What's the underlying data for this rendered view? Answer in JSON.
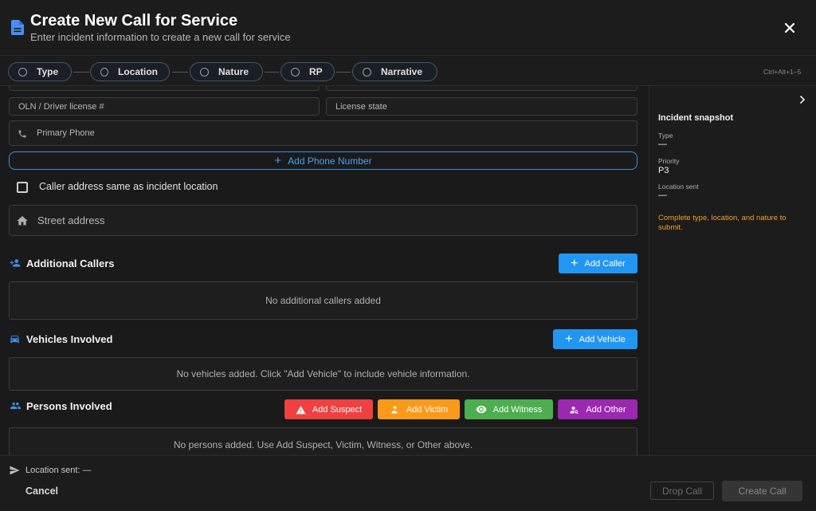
{
  "header": {
    "title": "Create New Call for Service",
    "subtitle": "Enter incident information to create a new call for service",
    "icons": {
      "document": "document-icon",
      "close": "close-icon"
    }
  },
  "stepper": {
    "steps": [
      {
        "label": "Type"
      },
      {
        "label": "Location"
      },
      {
        "label": "Nature"
      },
      {
        "label": "RP"
      },
      {
        "label": "Narrative"
      }
    ],
    "shortcut": "Ctrl+Alt+1–5"
  },
  "form": {
    "oln_placeholder": "OLN / Driver license #",
    "license_state_placeholder": "License state",
    "primary_phone_placeholder": "Primary Phone",
    "add_phone_label": "Add Phone Number",
    "same_address_label": "Caller address same as incident location",
    "street_address_placeholder": "Street address"
  },
  "additional_callers": {
    "title": "Additional Callers",
    "add_label": "Add Caller",
    "empty_text": "No additional callers added"
  },
  "vehicles": {
    "title": "Vehicles Involved",
    "add_label": "Add Vehicle",
    "empty_text": "No vehicles added. Click \"Add Vehicle\" to include vehicle information."
  },
  "persons": {
    "title": "Persons Involved",
    "buttons": [
      {
        "label": "Add Suspect",
        "color": "#f04040"
      },
      {
        "label": "Add Victim",
        "color": "#fb9a1a"
      },
      {
        "label": "Add Witness",
        "color": "#4cae4f"
      },
      {
        "label": "Add Other",
        "color": "#9c27b0"
      }
    ],
    "empty_text": "No persons added. Use Add Suspect, Victim, Witness, or Other above."
  },
  "snapshot": {
    "title": "Incident snapshot",
    "type_label": "Type",
    "type_value": "—",
    "priority_label": "Priority",
    "priority_value": "P3",
    "location_label": "Location sent",
    "location_value": "—",
    "warning": "Complete type, location, and nature to submit."
  },
  "footer": {
    "location_sent": "Location sent: —",
    "cancel_label": "Cancel",
    "drop_call_label": "Drop Call",
    "create_call_label": "Create Call"
  },
  "colors": {
    "accent_blue": "#2196f3",
    "warning": "#f0a030",
    "background": "#1a1a1a"
  }
}
